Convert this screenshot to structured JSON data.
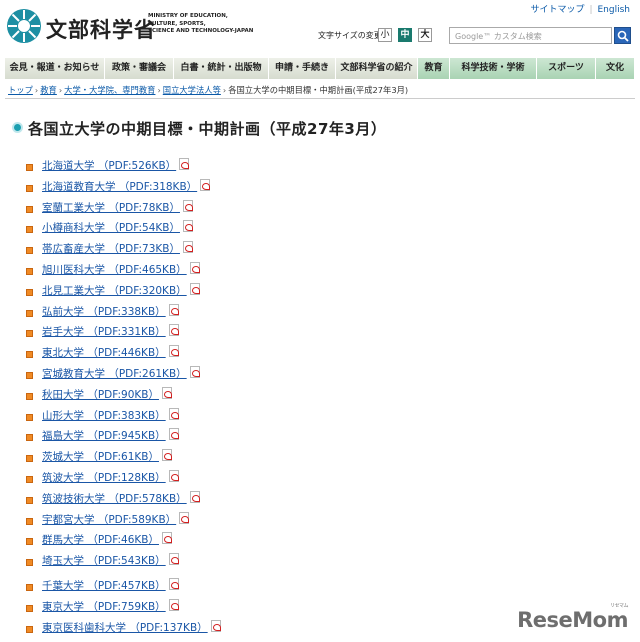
{
  "header": {
    "logo_text": "文部科学省",
    "logo_eng_lines": [
      "MINISTRY OF EDUCATION,",
      "CULTURE, SPORTS,",
      "SCIENCE AND TECHNOLOGY-JAPAN"
    ],
    "toplinks": [
      "サイトマップ",
      "English"
    ],
    "fontsize_label": "文字サイズの変更",
    "fontsize_small": "小",
    "fontsize_mid": "中",
    "fontsize_large": "大",
    "search_placeholder": "Google™ カスタム検索"
  },
  "nav": [
    {
      "label": "会見・報道・お知らせ",
      "w": 0
    },
    {
      "label": "政策・審議会"
    },
    {
      "label": "白書・統計・出版物"
    },
    {
      "label": "申請・手続き"
    },
    {
      "label": "文部科学省の紹介"
    },
    {
      "label": "教育"
    },
    {
      "label": "科学技術・学術"
    },
    {
      "label": "スポーツ"
    },
    {
      "label": "文化"
    }
  ],
  "breadcrumb": {
    "links": [
      "トップ",
      "教育",
      "大学・大学院、専門教育",
      "国立大学法人等"
    ],
    "current": "各国立大学の中期目標・中期計画(平成27年3月)"
  },
  "page_title": "各国立大学の中期目標・中期計画（平成27年3月）",
  "universities": [
    "北海道大学 （PDF:526KB）",
    "北海道教育大学 （PDF:318KB）",
    "室蘭工業大学 （PDF:78KB）",
    "小樽商科大学 （PDF:54KB）",
    "帯広畜産大学 （PDF:73KB）",
    "旭川医科大学 （PDF:465KB）",
    "北見工業大学 （PDF:320KB）",
    "弘前大学 （PDF:338KB）",
    "岩手大学 （PDF:331KB）",
    "東北大学 （PDF:446KB）",
    "宮城教育大学 （PDF:261KB）",
    "秋田大学 （PDF:90KB）",
    "山形大学 （PDF:383KB）",
    "福島大学 （PDF:945KB）",
    "茨城大学 （PDF:61KB）",
    "筑波大学 （PDF:128KB）",
    "筑波技術大学 （PDF:578KB）",
    "宇都宮大学 （PDF:589KB）",
    "群馬大学 （PDF:46KB）",
    "埼玉大学 （PDF:543KB）",
    "千葉大学 （PDF:457KB）",
    "東京大学 （PDF:759KB）",
    "東京医科歯科大学 （PDF:137KB）"
  ],
  "watermark": {
    "main": "ReseMom",
    "sub": "リセマム"
  }
}
